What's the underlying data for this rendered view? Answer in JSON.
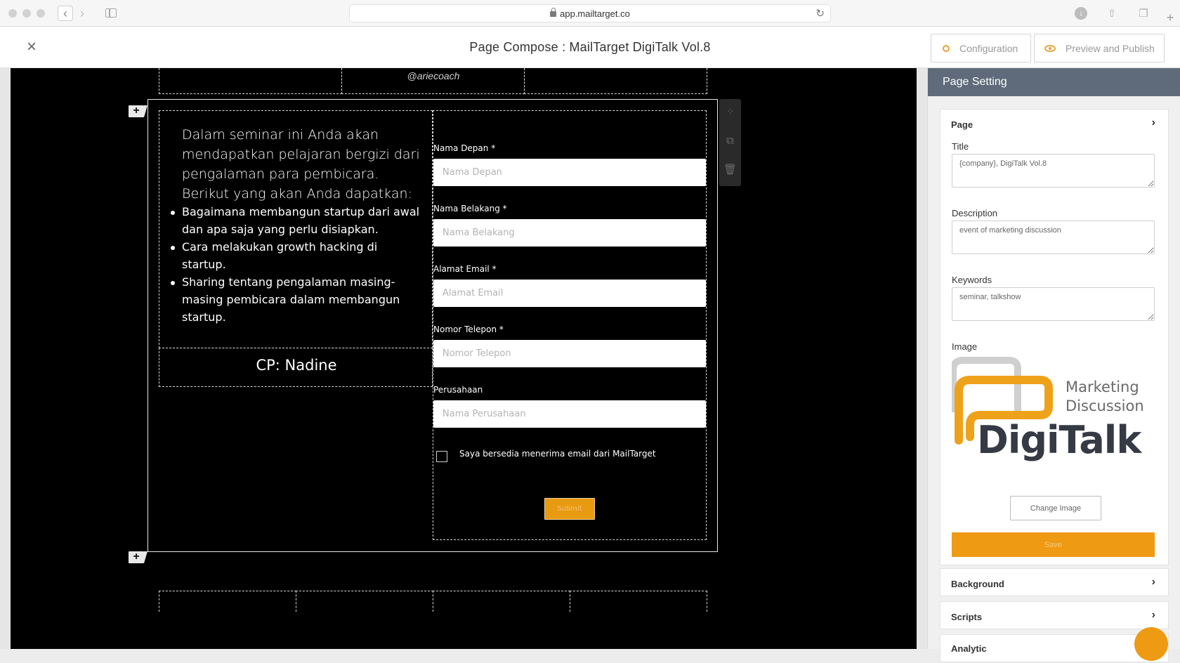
{
  "browser": {
    "url": "app.mailtarget.co"
  },
  "header": {
    "title": "Page Compose : MailTarget DigiTalk Vol.8",
    "configuration_label": "Configuration",
    "preview_label": "Preview and Publish"
  },
  "canvas": {
    "speaker_handle": "@ariecoach",
    "description": "Dalam seminar ini Anda akan mendapatkan pelajaran bergizi dari pengalaman para pembicara. Berikut yang akan Anda dapatkan:",
    "benefits": [
      "Bagaimana membangun startup dari awal dan apa saja yang perlu disiapkan.",
      "Cara melakukan growth hacking di startup.",
      "Sharing tentang pengalaman masing-masing pembicara dalam membangun startup."
    ],
    "contact": "CP: Nadine",
    "form": {
      "fields": [
        {
          "label": "Nama Depan *",
          "placeholder": "Nama Depan"
        },
        {
          "label": "Nama Belakang *",
          "placeholder": "Nama Belakang"
        },
        {
          "label": "Alamat Email *",
          "placeholder": "Alamat Email"
        },
        {
          "label": "Nomor Telepon *",
          "placeholder": "Nomor Telepon"
        },
        {
          "label": "Perusahaan",
          "placeholder": "Nama Perusahaan"
        }
      ],
      "consent": "Saya bersedia menerima email dari MailTarget",
      "submit_label": "Submit"
    },
    "add_block_label": "+"
  },
  "panel": {
    "title": "Page Setting",
    "page_section": "Page",
    "title_label": "Title",
    "title_value": "{company}, DigiTalk Vol.8",
    "description_label": "Description",
    "description_value": "event of marketing discussion",
    "keywords_label": "Keywords",
    "keywords_value": "seminar, talkshow",
    "image_label": "Image",
    "logo": {
      "line1": "Marketing",
      "line2": "Discussion",
      "brand": "DigiTalk"
    },
    "change_image_label": "Change Image",
    "save_label": "Save",
    "background_section": "Background",
    "scripts_section": "Scripts",
    "analytic_section": "Analytic"
  },
  "colors": {
    "accent": "#ee9a12",
    "panel_header": "#5f6b7a",
    "canvas_bg": "#000000"
  }
}
